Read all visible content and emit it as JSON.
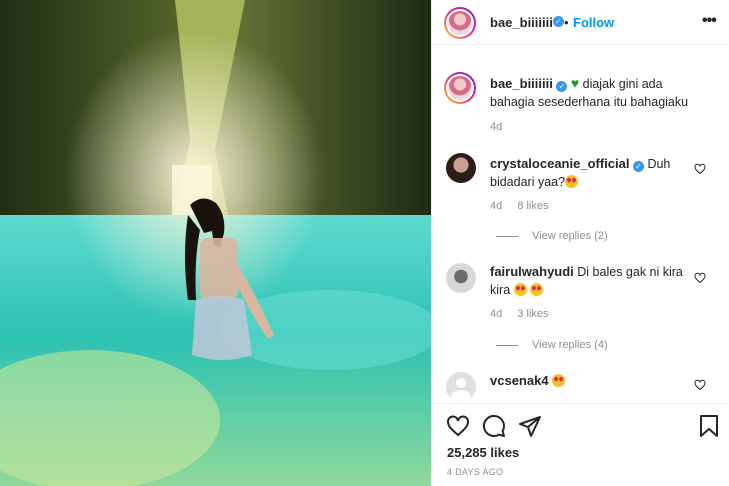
{
  "post": {
    "username": "bae_biiiiiii",
    "follow_label": "Follow",
    "separator": "•",
    "more_label": "•••",
    "caption_user": "bae_biiiiiii",
    "caption_text_1": "diajak gini ada",
    "caption_text_2": "bahagia sesederhana itu bahagiaku",
    "caption_time": "4d"
  },
  "comments": [
    {
      "user": "crystaloceanie_official",
      "verified": true,
      "text_1": "Duh",
      "text_2": "bidadari yaa?",
      "time": "4d",
      "likes": "8 likes",
      "replies": "View replies (2)"
    },
    {
      "user": "fairulwahyudi",
      "verified": false,
      "text_1": "Di bales gak ni kira",
      "text_2": "kira",
      "time": "4d",
      "likes": "3 likes",
      "replies": "View replies (4)"
    },
    {
      "user": "vcsenak4",
      "verified": false,
      "text_1": "",
      "text_2": ""
    }
  ],
  "footer": {
    "likes_count": "25,285 likes",
    "time_ago": "4 DAYS AGO"
  },
  "colors": {
    "follow_blue": "#0095f6",
    "verified_blue": "#3897f0",
    "meta_gray": "#8e8e8e",
    "water_turquoise": "#2ec9b8"
  },
  "icons": [
    "heart-icon",
    "comment-icon",
    "share-icon",
    "bookmark-icon",
    "more-options-icon",
    "verified-badge-icon",
    "heart-eyes-emoji-icon",
    "green-heart-emoji-icon"
  ]
}
